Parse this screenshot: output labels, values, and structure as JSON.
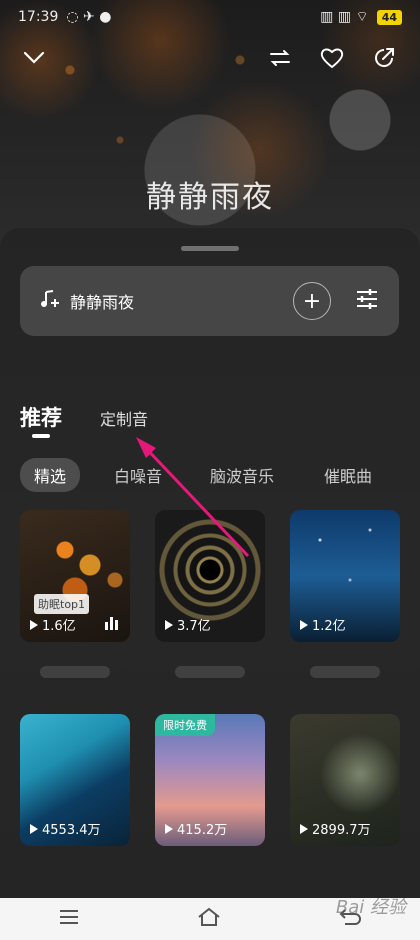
{
  "status_bar": {
    "time": "17:39",
    "battery": "44"
  },
  "title": "静静雨夜",
  "now_playing": {
    "name": "静静雨夜",
    "add": "+"
  },
  "tabs": [
    {
      "label": "推荐"
    },
    {
      "label": "定制音"
    }
  ],
  "subtabs": [
    {
      "label": "精选"
    },
    {
      "label": "白噪音"
    },
    {
      "label": "脑波音乐"
    },
    {
      "label": "催眠曲"
    }
  ],
  "cards": [
    {
      "count": "1.6亿",
      "badge": "助眠top1"
    },
    {
      "count": "3.7亿"
    },
    {
      "count": "1.2亿"
    },
    {
      "count": "4553.4万"
    },
    {
      "count": "415.2万",
      "badge": "限时免费"
    },
    {
      "count": "2899.7万"
    }
  ],
  "watermark": "Bai 经验",
  "colors": {
    "accent_arrow": "#e6197a",
    "free_badge": "#2fb8a0",
    "battery": "#f4d400"
  }
}
